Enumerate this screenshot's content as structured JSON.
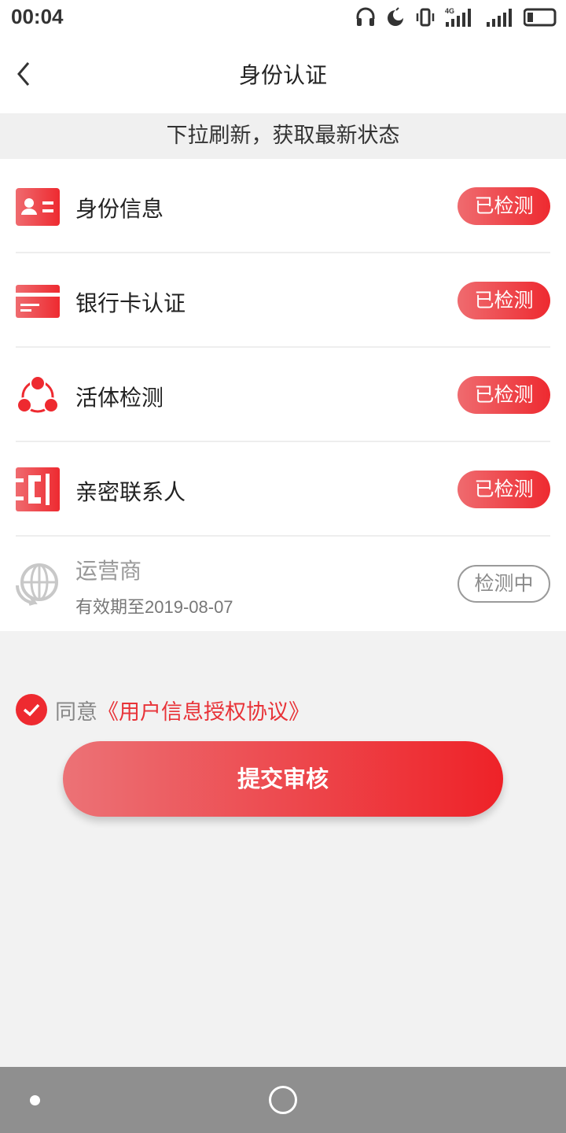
{
  "status_bar": {
    "time": "00:04",
    "network_label": "4G"
  },
  "nav": {
    "title": "身份认证"
  },
  "banner": {
    "text": "下拉刷新，获取最新状态"
  },
  "items": [
    {
      "label": "身份信息",
      "status": "已检测",
      "icon": "id-card-icon"
    },
    {
      "label": "银行卡认证",
      "status": "已检测",
      "icon": "bank-card-icon"
    },
    {
      "label": "活体检测",
      "status": "已检测",
      "icon": "face-detect-icon"
    },
    {
      "label": "亲密联系人",
      "status": "已检测",
      "icon": "contacts-icon"
    },
    {
      "label": "运营商",
      "sublabel": "有效期至2019-08-07",
      "status": "检测中",
      "icon": "carrier-globe-icon"
    }
  ],
  "agreement": {
    "prefix": "同意",
    "link": "《用户信息授权协议》",
    "checked": true
  },
  "submit": {
    "label": "提交审核"
  },
  "colors": {
    "accent": "#ee2a30",
    "accent_light": "#ef6b6f",
    "page_bg": "#f2f2f2",
    "pending_gray": "#9a9a9a"
  }
}
